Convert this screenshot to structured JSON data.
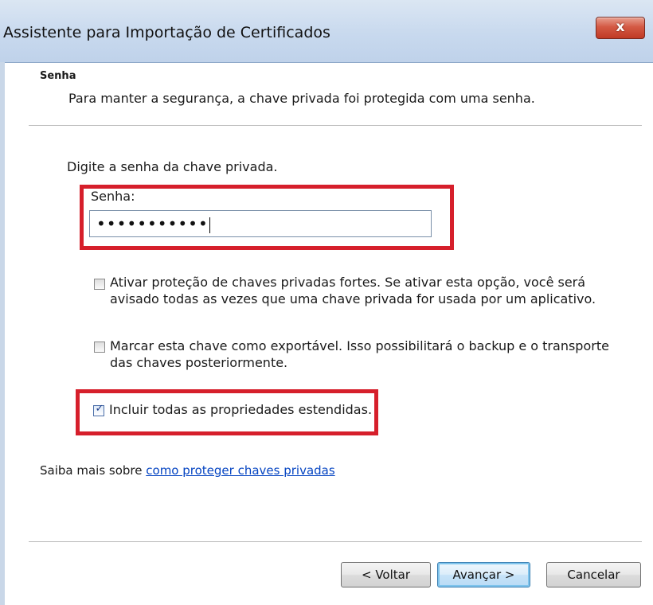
{
  "window": {
    "title": "Assistente para Importação de Certificados",
    "close_glyph": "x"
  },
  "header": {
    "title": "Senha",
    "description": "Para manter a segurança, a chave privada foi protegida com uma senha."
  },
  "form": {
    "prompt": "Digite a senha da chave privada.",
    "password_label": "Senha:",
    "password_value": "•••••••••••"
  },
  "options": [
    {
      "line1": "Ativar proteção de chaves privadas fortes. Se ativar esta opção, você será",
      "line2": "avisado todas as vezes que uma chave privada for usada por um aplicativo.",
      "checked": false
    },
    {
      "line1": "Marcar esta chave como exportável. Isso possibilitará o backup e o transporte",
      "line2": "das chaves posteriormente.",
      "checked": false
    },
    {
      "line1": "Incluir todas as propriedades estendidas.",
      "checked": true
    }
  ],
  "learn_more": {
    "prefix": "Saiba mais sobre ",
    "link": "como proteger chaves privadas"
  },
  "buttons": {
    "back": "< Voltar",
    "next": "Avançar >",
    "cancel": "Cancelar"
  },
  "colors": {
    "highlight": "#d61f2b",
    "link": "#0645c2",
    "titlebar": "#c8d9ee"
  }
}
